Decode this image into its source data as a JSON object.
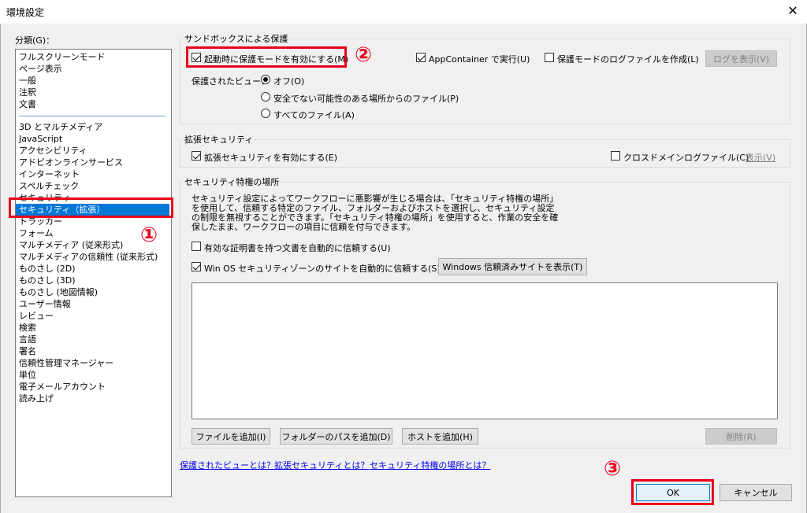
{
  "window": {
    "title": "環境設定",
    "close": "✕"
  },
  "category": {
    "label": "分類(G)：",
    "items": [
      "フルスクリーンモード",
      "ページ表示",
      "一般",
      "注釈",
      "文書",
      "3D とマルチメディア",
      "JavaScript",
      "アクセシビリティ",
      "アドビオンラインサービス",
      "インターネット",
      "スペルチェック",
      "セキュリティ",
      "セキュリティ（拡張）",
      "トラッカー",
      "フォーム",
      "マルチメディア (従来形式)",
      "マルチメディアの信頼性 (従来形式)",
      "ものさし (2D)",
      "ものさし (3D)",
      "ものさし (地図情報)",
      "ユーザー情報",
      "レビュー",
      "検索",
      "言語",
      "署名",
      "信頼性管理マネージャー",
      "単位",
      "電子メールアカウント",
      "読み上げ"
    ]
  },
  "sandbox": {
    "title": "サンドボックスによる保護",
    "protected_mode": "起動時に保護モードを有効にする(M)",
    "app_container": "AppContainer で実行(U)",
    "log_file": "保護モードのログファイルを作成(L)",
    "view_log": "ログを表示(V)",
    "protected_view_label": "保護されたビュー：",
    "radio_off": "オフ(O)",
    "radio_unsafe": "安全でない可能性のある場所からのファイル(P)",
    "radio_all": "すべてのファイル(A)"
  },
  "enhanced": {
    "title": "拡張セキュリティ",
    "enable": "拡張セキュリティを有効にする(E)",
    "cross_domain": "クロスドメインログファイル(C)",
    "show": "表示(V)"
  },
  "privileged": {
    "title": "セキュリティ特権の場所",
    "description": "セキュリティ設定によってワークフローに悪影響が生じる場合は、「セキュリティ特権の場所」を使用して、信頼する特定のファイル、フォルダーおよびホストを選択し、セキュリティ設定の制限を無視することができます。「セキュリティ特権の場所」を使用すると、作業の安全を確保したまま、ワークフローの項目に信頼を付与できます。",
    "trust_cert": "有効な証明書を持つ文書を自動的に信頼する(U)",
    "trust_zone": "Win OS セキュリティゾーンのサイトを自動的に信頼する(S)",
    "show_sites": "Windows 信頼済みサイトを表示(T)",
    "add_file": "ファイルを追加(I)",
    "add_folder": "フォルダーのパスを追加(D)",
    "add_host": "ホストを追加(H)",
    "remove": "削除(R)"
  },
  "links": {
    "protected_view": "保護されたビューとは？",
    "enhanced": "拡張セキュリティとは？",
    "privileged": "セキュリティ特権の場所とは？"
  },
  "footer": {
    "ok": "OK",
    "cancel": "キャンセル"
  },
  "annotations": {
    "one": "①",
    "two": "②",
    "three": "③"
  },
  "colors": {
    "accent": "#0078d7",
    "highlight": "#e8001c"
  }
}
